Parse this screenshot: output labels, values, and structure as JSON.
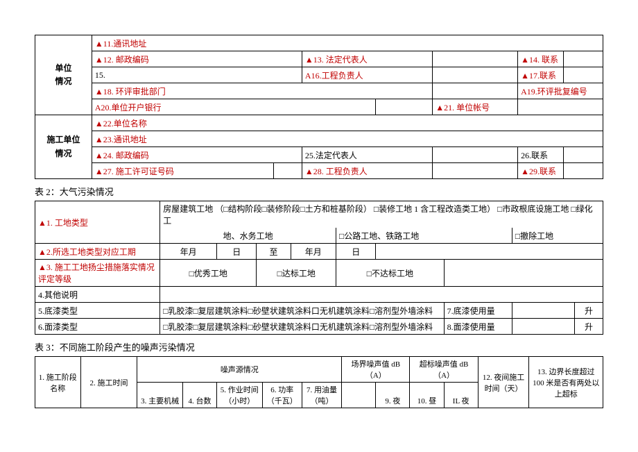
{
  "table1": {
    "group1_label": "单位\n情况",
    "group2_label": "施工单位\n情况",
    "r1": {
      "c1": "▲11.通讯地址"
    },
    "r2": {
      "c1": "▲12. 邮政编码",
      "c2": "▲13. 法定代表人",
      "c3": "▲14. 联系"
    },
    "r3": {
      "c1": "15.",
      "c2": "A16.工程负责人",
      "c3": "▲17.联系"
    },
    "r4": {
      "c1": "▲18. 环评审批部门",
      "c2": "A19.环评批复编号"
    },
    "r5": {
      "c1": "A20.单位开户银行",
      "c2": "▲21. 单位帐号"
    },
    "r6": {
      "c1": "▲22.单位名称"
    },
    "r7": {
      "c1": "▲23.通讯地址"
    },
    "r8": {
      "c1": "▲24. 邮政编码",
      "c2": "25.法定代表人",
      "c3": "26.联系"
    },
    "r9": {
      "c1": "▲27. 施工许可证号码",
      "c2": "▲28. 工程负责人",
      "c3": "▲29.联系"
    }
  },
  "section2_title": "表 2：大气污染情况",
  "table2": {
    "r1": {
      "label": "▲1. 工地类型",
      "line1": "房屋建筑工地 （□结构阶段□装修阶段□土方和桩基阶段） □装修工地 1 含工程改造类工地） □市政根底设施工地  □绿化工",
      "line2_a": "地、水务工地",
      "line2_b": "□公路工地、铁路工地",
      "line2_c": "□撤除工地"
    },
    "r2": {
      "label": "▲2.所选工地类型对应工期",
      "ym1": "年月",
      "d1": "日",
      "to": "至",
      "ym2": "年月",
      "d2": "日"
    },
    "r3": {
      "label": "▲3. 施工工地扬尘措施落实情况评定等级",
      "a": "□优秀工地",
      "b": "□达标工地",
      "c": "□不达标工地"
    },
    "r4": {
      "label": "4.其他说明"
    },
    "r5": {
      "label": "5.底漆类型",
      "opts": "□乳胶漆□复层建筑涂料□砂壁状建筑涂料口无机建筑涂料□溶剂型外墙涂料",
      "amount_label": "7.底漆使用量",
      "unit": "升"
    },
    "r6": {
      "label": "6.面漆类型",
      "opts": "□乳胶漆□复层建筑涂料□砂壁状建筑涂料口无机建筑涂料□溶剂型外墙涂料",
      "amount_label": "8.面漆使用量",
      "unit": "升"
    }
  },
  "section3_title": "表 3：不同施工阶段产生的噪声污染情况",
  "table3": {
    "h1": "1. 施工阶段名称",
    "h2": "2. 施工时间",
    "h_noise": "噪声源情况",
    "h3": "3. 主要机械",
    "h4": "4. 台数",
    "h5": "5. 作业时间（小时）",
    "h6": "6. 功率（千瓦）",
    "h7": "7. 用油量（吨）",
    "h_field": "场界噪声值 dB（A）",
    "h_exceed": "超标噪声值 dB（A）",
    "h9": "9. 夜",
    "h10": "10. 昼",
    "h11": "IL 夜",
    "h12": "12. 夜间施工时间（天）",
    "h13": "13. 边界长度超过 100 米是否有两处以上超标"
  }
}
